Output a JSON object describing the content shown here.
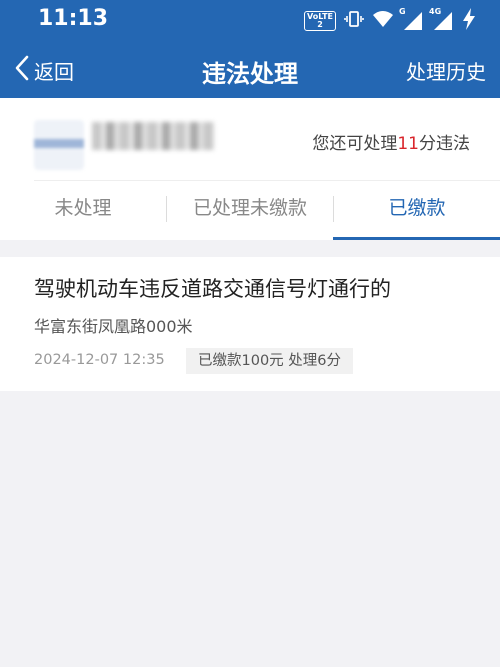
{
  "status_bar": {
    "time": "11:13",
    "volte": "VoLTE",
    "volte_sim": "2",
    "net1": "G",
    "net2": "4G"
  },
  "header": {
    "back_label": "返回",
    "title": "违法处理",
    "history_label": "处理历史",
    "color": "#2467b3"
  },
  "summary": {
    "prefix": "您还可处理",
    "points": "11",
    "suffix": "分违法",
    "highlight_color": "#d9262c"
  },
  "tabs": [
    {
      "label": "未处理",
      "active": false
    },
    {
      "label": "已处理未缴款",
      "active": false
    },
    {
      "label": "已缴款",
      "active": true
    }
  ],
  "records": [
    {
      "title": "驾驶机动车违反道路交通信号灯通行的",
      "location": "华富东街凤凰路000米",
      "time": "2024-12-07 12:35",
      "status": "已缴款100元 处理6分"
    }
  ]
}
